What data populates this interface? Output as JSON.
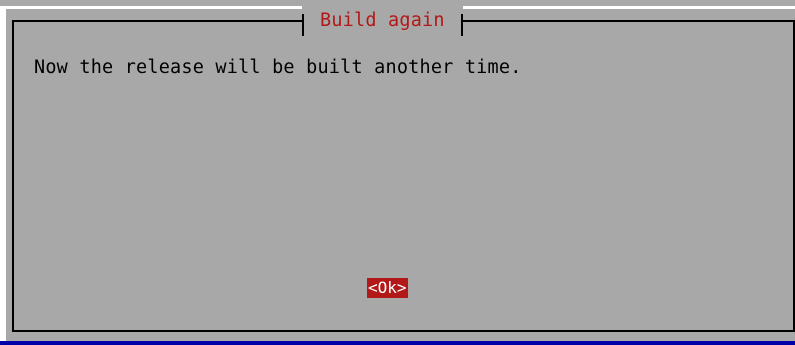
{
  "dialog": {
    "title": "Build again",
    "message": "Now the release will be built another time.",
    "ok_label": "<Ok>"
  },
  "colors": {
    "background": "#0000a8",
    "dialog_bg": "#a8a8a8",
    "title_text": "#b21818",
    "button_bg": "#b21818",
    "button_text": "#ffffff"
  }
}
